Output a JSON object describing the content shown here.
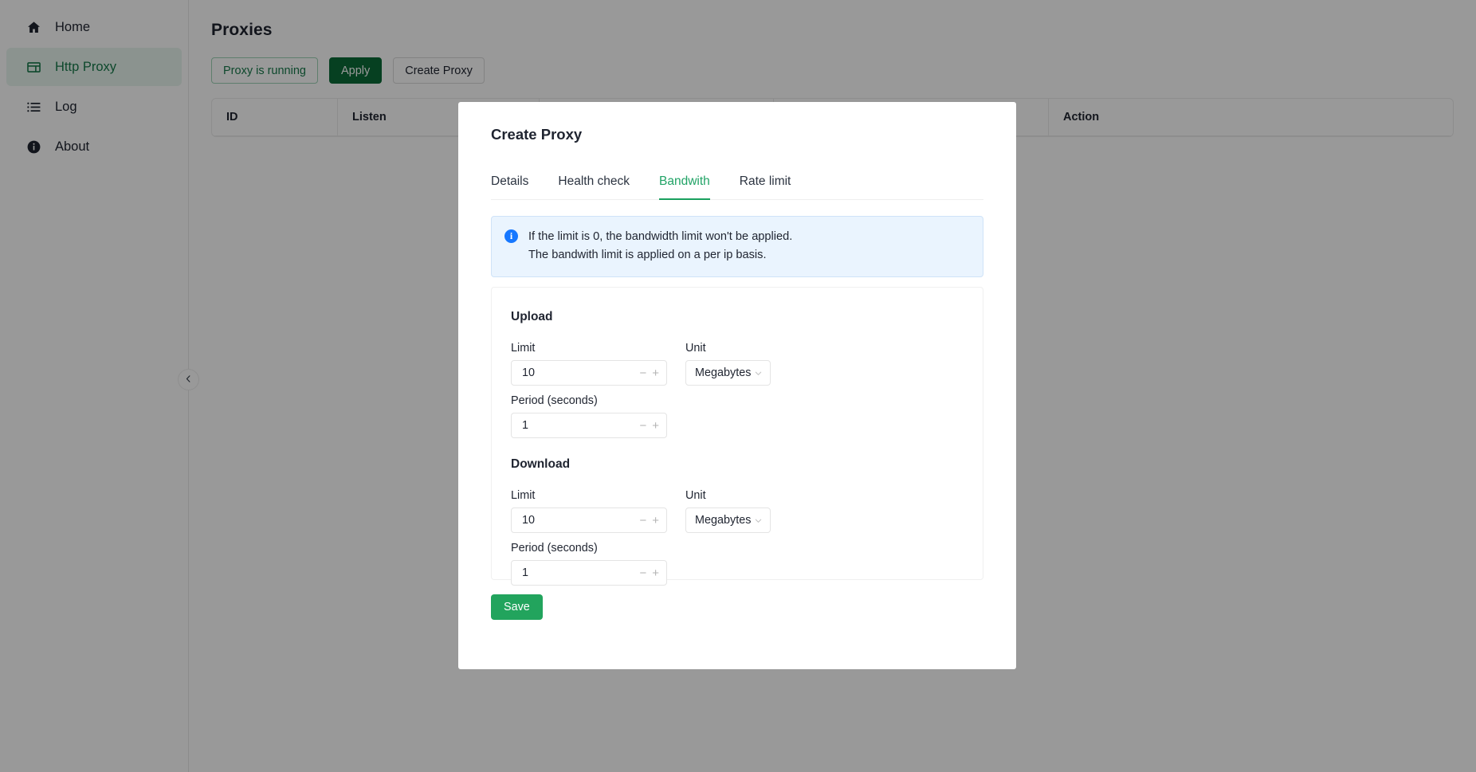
{
  "sidebar": {
    "items": [
      {
        "label": "Home",
        "icon": "home-icon",
        "active": false
      },
      {
        "label": "Http Proxy",
        "icon": "proxy-table-icon",
        "active": true
      },
      {
        "label": "Log",
        "icon": "list-icon",
        "active": false
      },
      {
        "label": "About",
        "icon": "info-circle-icon",
        "active": false
      }
    ]
  },
  "page": {
    "title": "Proxies",
    "toolbar": {
      "status_label": "Proxy is running",
      "apply_label": "Apply",
      "create_label": "Create Proxy"
    },
    "table": {
      "columns": [
        "ID",
        "Listen",
        "",
        "",
        "Action"
      ]
    },
    "collapse_icon": "chevron-left-icon"
  },
  "modal": {
    "title": "Create Proxy",
    "tabs": [
      {
        "label": "Details",
        "active": false
      },
      {
        "label": "Health check",
        "active": false
      },
      {
        "label": "Bandwith",
        "active": true
      },
      {
        "label": "Rate limit",
        "active": false
      }
    ],
    "alert": {
      "icon": "info-icon",
      "line1": "If the limit is 0, the bandwidth limit won't be applied.",
      "line2": "The bandwith limit is applied on a per ip basis."
    },
    "upload": {
      "section_title": "Upload",
      "limit_label": "Limit",
      "limit_value": "10",
      "unit_label": "Unit",
      "unit_value": "Megabytes",
      "period_label": "Period (seconds)",
      "period_value": "1"
    },
    "download": {
      "section_title": "Download",
      "limit_label": "Limit",
      "limit_value": "10",
      "unit_label": "Unit",
      "unit_value": "Megabytes",
      "period_label": "Period (seconds)",
      "period_value": "1"
    },
    "save_label": "Save",
    "stepper": {
      "minus": "−",
      "plus": "+"
    }
  },
  "colors": {
    "accent_green": "#22a45a",
    "primary_green": "#0a6b37",
    "tab_active": "#21a366",
    "info_blue": "#1677ff",
    "alert_bg": "#eaf4fe"
  }
}
